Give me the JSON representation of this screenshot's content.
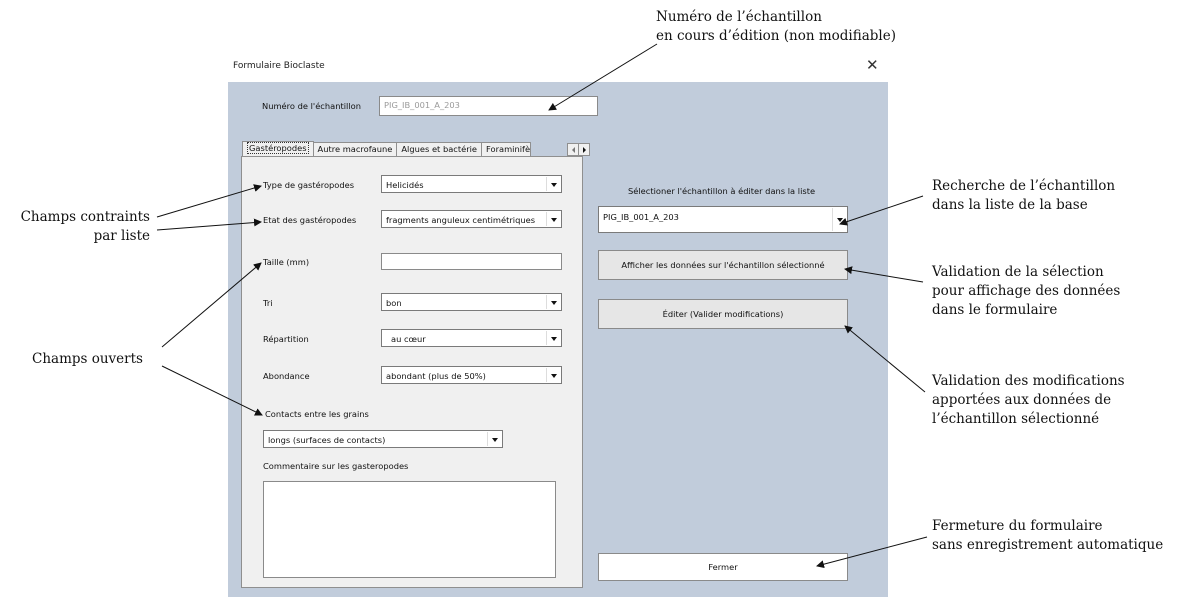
{
  "annotations": {
    "sample_number": [
      "Numéro de l’échantillon",
      "en cours d’édition (non modifiable)"
    ],
    "constrained_fields": [
      "Champs contraints",
      "par liste"
    ],
    "open_fields": [
      "Champs ouverts"
    ],
    "search_sample": [
      "Recherche de l’échantillon",
      "dans la liste de la base"
    ],
    "validate_selection": [
      "Validation de la sélection",
      "pour affichage des données",
      "dans le formulaire"
    ],
    "validate_edits": [
      "Validation des modifications",
      "apportées aux données de",
      "l’échantillon sélectionné"
    ],
    "close_form": [
      "Fermeture du formulaire",
      "sans enregistrement automatique"
    ]
  },
  "form": {
    "title": "Formulaire Bioclaste",
    "close_glyph": "✕",
    "sample_label": "Numéro de l'échantillon",
    "sample_value": "PIG_IB_001_A_203",
    "tabs": [
      "Gastéropodes",
      "Autre macrofaune",
      "Algues et bactérie",
      "Foraminifèr"
    ],
    "active_tab": "Gastéropodes",
    "fields": {
      "type_label": "Type de gastéropodes",
      "type_value": "Helicidés",
      "etat_label": "Etat des gastéropodes",
      "etat_value": "fragments anguleux centimétriques",
      "taille_label": "Taille (mm)",
      "taille_value": "",
      "tri_label": "Tri",
      "tri_value": "bon",
      "repartition_label": "Répartition",
      "repartition_value": "au cœur",
      "abondance_label": "Abondance",
      "abondance_value": "abondant (plus de 50%)",
      "contacts_label": "Contacts entre les grains",
      "contacts_value": "longs (surfaces de contacts)",
      "commentaire_label": "Commentaire sur les gasteropodes",
      "commentaire_value": ""
    },
    "right": {
      "select_label": "Sélectioner l'échantillon à éditer dans la liste",
      "select_value": "PIG_IB_001_A_203",
      "show_button": "Afficher les données sur l'échantillon sélectionné",
      "edit_button": "Éditer (Valider modifications)",
      "close_button": "Fermer"
    }
  },
  "colors": {
    "form_background": "#c1ccdb",
    "panel_background": "#f0f0f0",
    "button_background": "#e6e6e6"
  }
}
